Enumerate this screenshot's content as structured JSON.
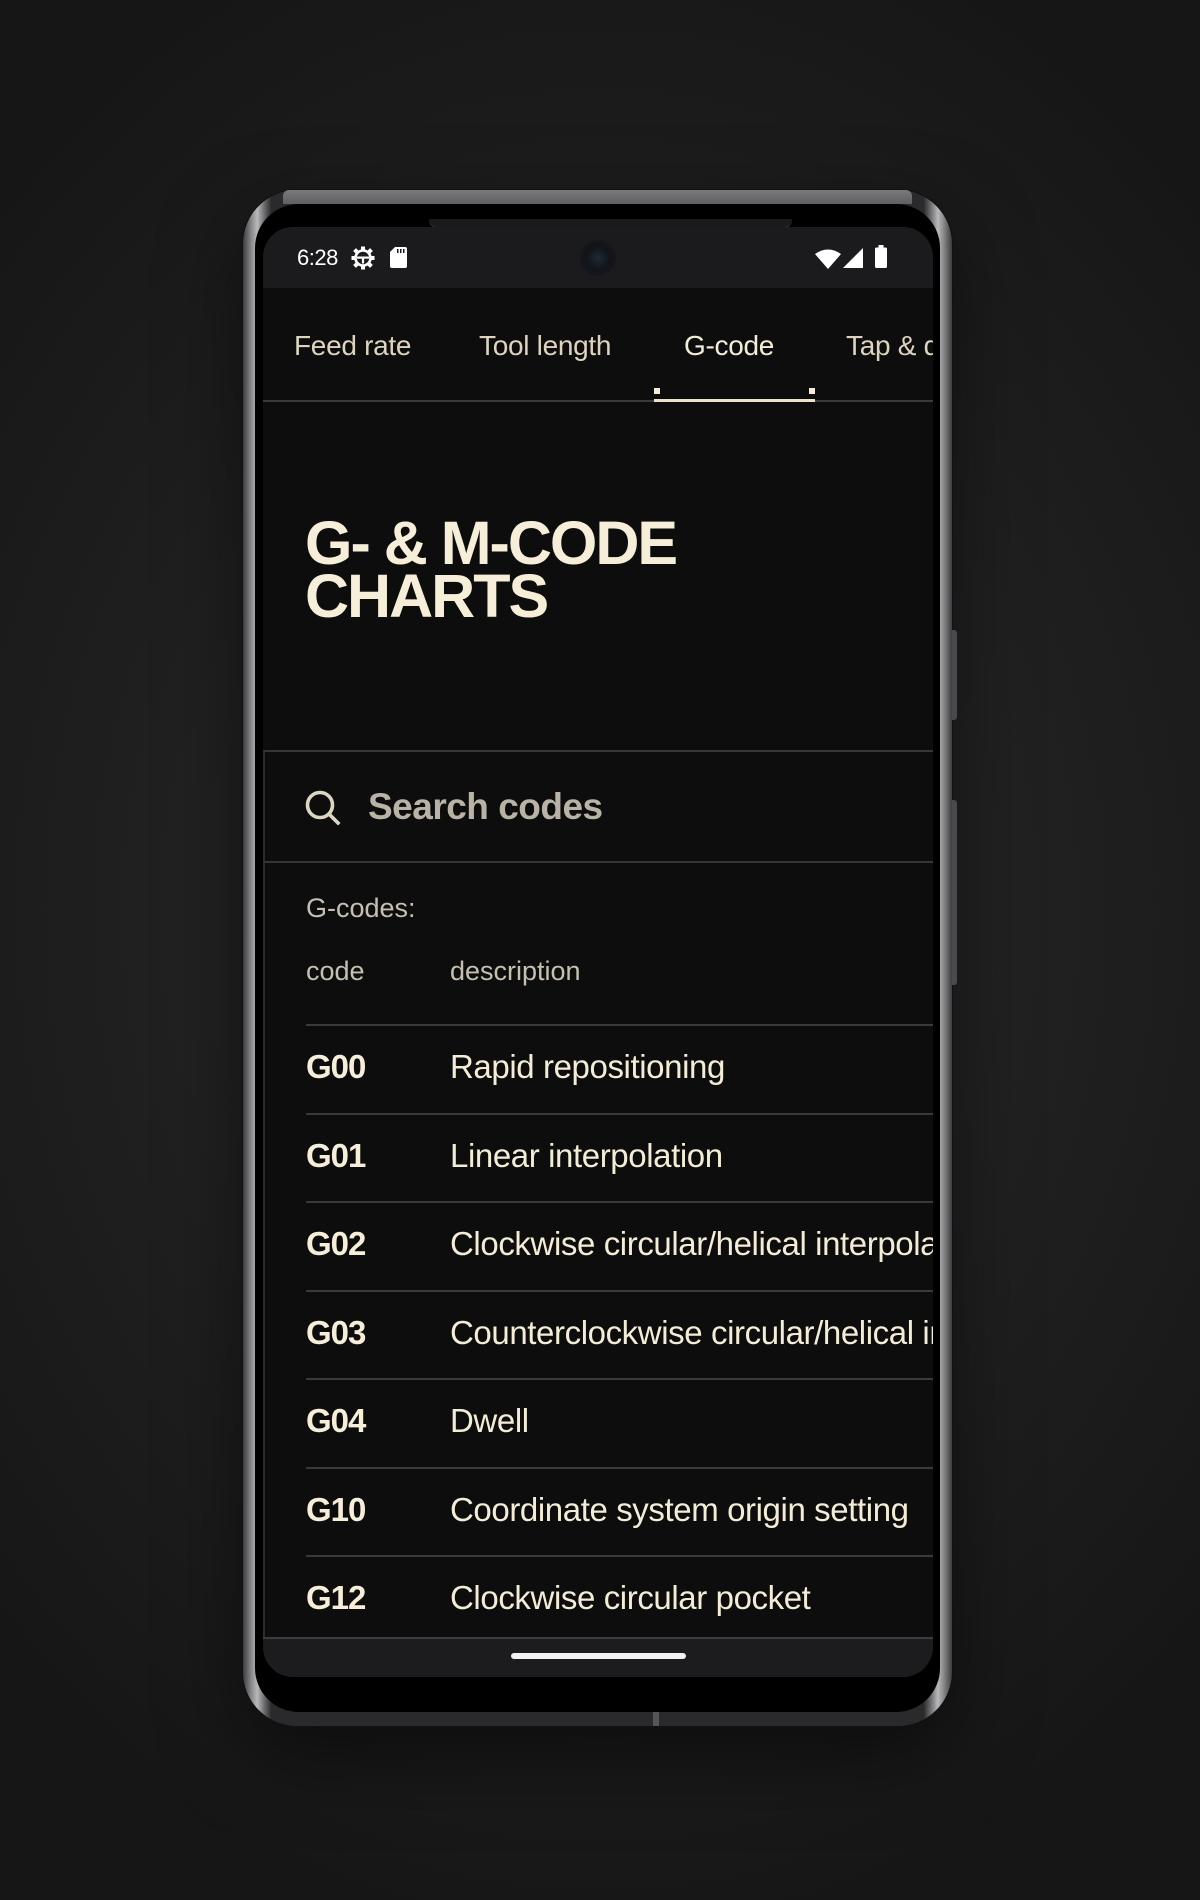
{
  "status_bar": {
    "time": "6:28",
    "left_icons": [
      "settings-gear-icon",
      "sd-card-icon"
    ],
    "right_icons": [
      "wifi-icon",
      "cellular-signal-icon",
      "battery-icon"
    ]
  },
  "tabs": [
    {
      "label": "Feed rate",
      "active": false
    },
    {
      "label": "Tool length",
      "active": false
    },
    {
      "label": "G-code",
      "active": true
    },
    {
      "label": "Tap & d",
      "active": false
    }
  ],
  "page": {
    "title_line1": "G- & M-CODE",
    "title_line2": "CHARTS"
  },
  "search": {
    "placeholder": "Search codes",
    "value": "",
    "icon": "search-icon"
  },
  "gcodes": {
    "section_label": "G-codes:",
    "columns": {
      "code": "code",
      "description": "description"
    },
    "rows": [
      {
        "code": "G00",
        "description": "Rapid repositioning"
      },
      {
        "code": "G01",
        "description": "Linear interpolation"
      },
      {
        "code": "G02",
        "description": "Clockwise circular/helical interpolation"
      },
      {
        "code": "G03",
        "description": "Counterclockwise circular/helical interpolation"
      },
      {
        "code": "G04",
        "description": "Dwell"
      },
      {
        "code": "G10",
        "description": "Coordinate system origin setting"
      },
      {
        "code": "G12",
        "description": "Clockwise circular pocket"
      }
    ]
  },
  "theme": {
    "background": "#0d0d0d",
    "text_cream": "#f3ecd6",
    "muted_text": "#c6c0b2",
    "divider": "#3a3a3a"
  }
}
